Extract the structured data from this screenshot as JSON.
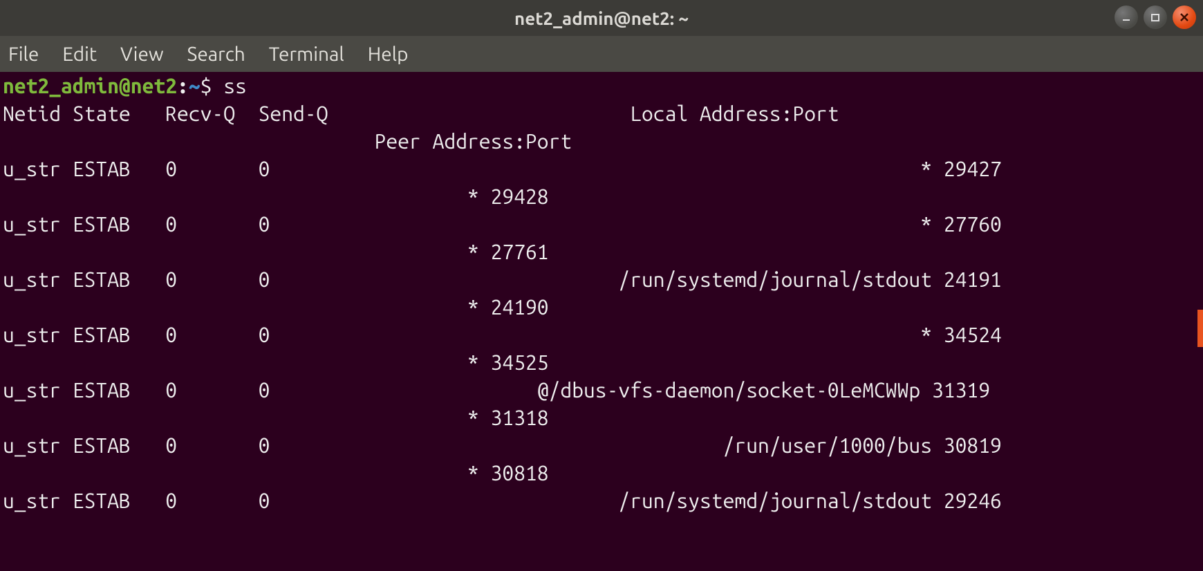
{
  "titlebar": {
    "title": "net2_admin@net2: ~"
  },
  "menubar": {
    "items": [
      "File",
      "Edit",
      "View",
      "Search",
      "Terminal",
      "Help"
    ]
  },
  "prompt": {
    "user_host": "net2_admin@net2",
    "colon": ":",
    "path": "~",
    "dollar": "$ ",
    "command": "ss"
  },
  "header": {
    "line1": "Netid State   Recv-Q  Send-Q                          Local Address:Port  ",
    "line2": "                                Peer Address:Port"
  },
  "rows": [
    {
      "l": "u_str ESTAB   0       0                                                        * 29427",
      "p": "                                        * 29428"
    },
    {
      "l": "u_str ESTAB   0       0                                                        * 27760",
      "p": "                                        * 27761"
    },
    {
      "l": "u_str ESTAB   0       0                              /run/systemd/journal/stdout 24191",
      "p": "                                        * 24190"
    },
    {
      "l": "u_str ESTAB   0       0                                                        * 34524",
      "p": "                                        * 34525"
    },
    {
      "l": "u_str ESTAB   0       0                       @/dbus-vfs-daemon/socket-0LeMCWWp 31319",
      "p": "                                        * 31318"
    },
    {
      "l": "u_str ESTAB   0       0                                       /run/user/1000/bus 30819",
      "p": "                                        * 30818"
    },
    {
      "l": "u_str ESTAB   0       0                              /run/systemd/journal/stdout 29246",
      "p": ""
    }
  ]
}
